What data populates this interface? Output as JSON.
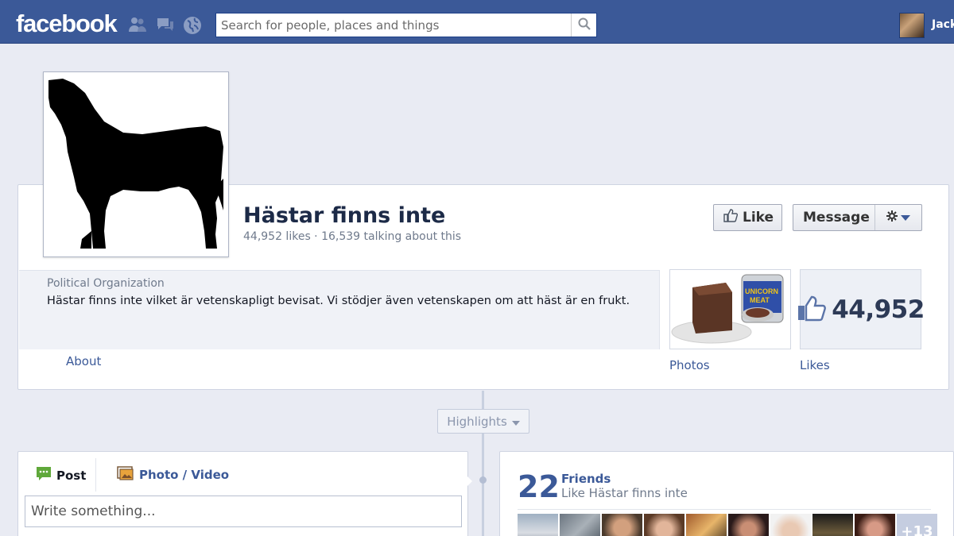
{
  "topbar": {
    "logo": "facebook",
    "search_placeholder": "Search for people, places and things",
    "user_name": "Jack",
    "icons": [
      "friend-requests-icon",
      "messages-icon",
      "notifications-globe-icon",
      "search-icon"
    ]
  },
  "page": {
    "name": "Hästar finns inte",
    "stats": "44,952 likes · 16,539 talking about this",
    "like_button": "Like",
    "message_button": "Message",
    "category": "Political Organization",
    "description": "Hästar finns inte vilket är vetenskapligt bevisat. Vi stödjer även vetenskapen om att häst är en frukt.",
    "about_link": "About",
    "photos_label": "Photos",
    "likes_label": "Likes",
    "likes_count": "44,952"
  },
  "timeline": {
    "highlights_label": "Highlights",
    "composer": {
      "post_tab": "Post",
      "photo_tab": "Photo / Video",
      "placeholder": "Write something..."
    },
    "friends": {
      "count": "22",
      "title": "Friends",
      "subtitle": "Like Hästar finns inte",
      "more": "+13"
    }
  },
  "colors": {
    "brand_blue": "#3b5998",
    "page_bg": "#e9ebf3",
    "link": "#3b5998"
  }
}
